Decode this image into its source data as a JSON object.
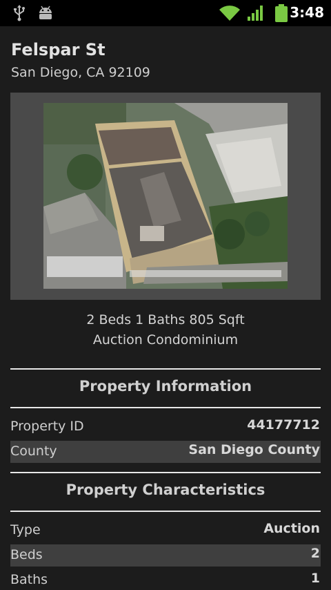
{
  "status_bar": {
    "time": "3:48",
    "icons": [
      "usb-icon",
      "android-debug-icon",
      "wifi-icon",
      "signal-icon",
      "battery-icon"
    ]
  },
  "property": {
    "street": "Felspar St",
    "city_line": "San Diego, CA 92109",
    "photo_icon": "aerial-photo",
    "summary_line1": "2 Beds 1 Baths 805 Sqft",
    "summary_line2": "Auction Condominium"
  },
  "sections": {
    "info": {
      "title": "Property Information",
      "rows": [
        {
          "label": "Property ID",
          "value": "44177712"
        },
        {
          "label": "County",
          "value": "San Diego County"
        }
      ]
    },
    "characteristics": {
      "title": "Property Characteristics",
      "rows": [
        {
          "label": "Type",
          "value": "Auction"
        },
        {
          "label": "Beds",
          "value": "2"
        },
        {
          "label": "Baths",
          "value": "1"
        }
      ]
    }
  },
  "colors": {
    "background": "#1c1c1c",
    "status_bar": "#000000",
    "status_green": "#7ac943",
    "row_shade": "#3f3f3f",
    "divider": "#e8e8e8"
  }
}
